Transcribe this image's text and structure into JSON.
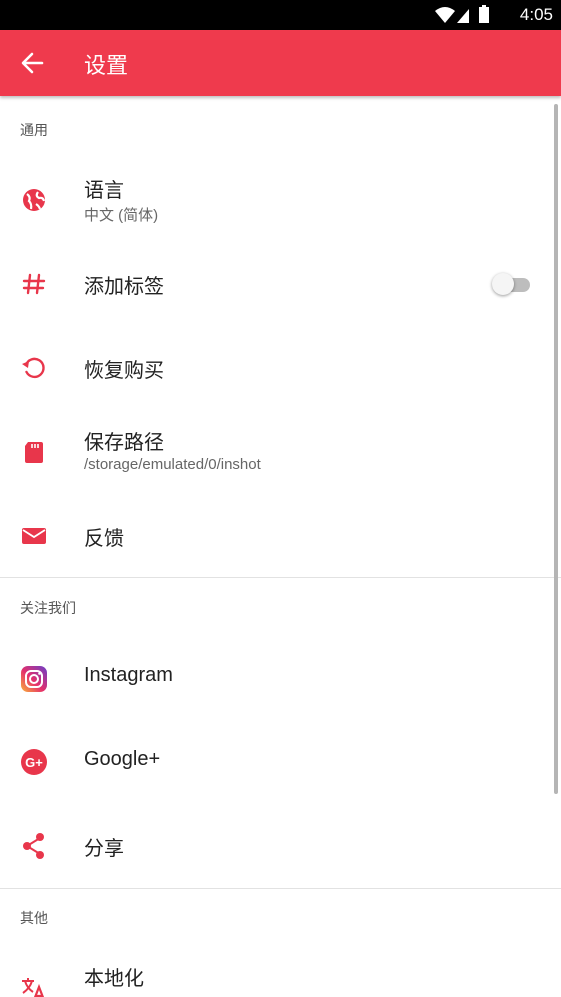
{
  "status_bar": {
    "time": "4:05"
  },
  "app_bar": {
    "title": "设置"
  },
  "sections": {
    "general": {
      "header": "通用",
      "language": {
        "title": "语言",
        "subtitle": "中文 (简体)"
      },
      "add_tags": {
        "title": "添加标签",
        "enabled": false
      },
      "restore_purchase": {
        "title": "恢复购买"
      },
      "save_path": {
        "title": "保存路径",
        "subtitle": "/storage/emulated/0/inshot"
      },
      "feedback": {
        "title": "反馈"
      }
    },
    "follow_us": {
      "header": "关注我们",
      "instagram": {
        "title": "Instagram"
      },
      "google_plus": {
        "title": "Google+"
      },
      "share": {
        "title": "分享"
      }
    },
    "other": {
      "header": "其他",
      "localization": {
        "title": "本地化"
      }
    }
  },
  "colors": {
    "accent": "#ef3a4d",
    "status_bar": "#000000",
    "text_primary": "#222222",
    "text_secondary": "#666666"
  },
  "icons": [
    "back-arrow-icon",
    "globe-icon",
    "hashtag-icon",
    "restore-icon",
    "sd-card-icon",
    "mail-icon",
    "instagram-icon",
    "google-plus-icon",
    "share-icon",
    "translate-icon"
  ]
}
